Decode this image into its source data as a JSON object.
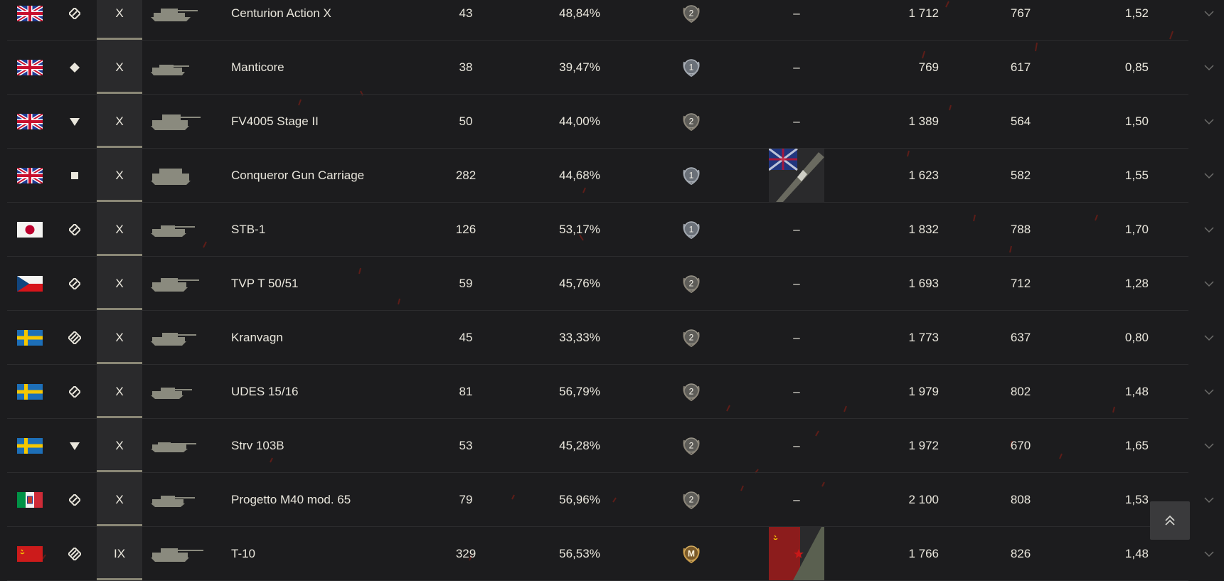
{
  "colors": {
    "background": "#1c1c1e",
    "row_border": "#2c2c2e",
    "text": "#e9e6dc",
    "tank_silhouette": "#8a8a7e",
    "tier_cell": "#2a2a2c",
    "tier_bar": "#8a8776"
  },
  "scroll_top_icon": "double-chevron-up-icon",
  "expand_icon": "chevron-down-icon",
  "rows": [
    {
      "nation": "uk",
      "class": "medium",
      "tier": "X",
      "name": "Centurion Action X",
      "battles": "43",
      "winrate": "48,84%",
      "mastery": "2",
      "mark": "–",
      "damage": "1 712",
      "xp": "767",
      "kd": "1,52"
    },
    {
      "nation": "uk",
      "class": "light",
      "tier": "X",
      "name": "Manticore",
      "battles": "38",
      "winrate": "39,47%",
      "mastery": "1",
      "mark": "–",
      "damage": "769",
      "xp": "617",
      "kd": "0,85"
    },
    {
      "nation": "uk",
      "class": "td",
      "tier": "X",
      "name": "FV4005 Stage II",
      "battles": "50",
      "winrate": "44,00%",
      "mastery": "2",
      "mark": "–",
      "damage": "1 389",
      "xp": "564",
      "kd": "1,50"
    },
    {
      "nation": "uk",
      "class": "spg",
      "tier": "X",
      "name": "Conqueror Gun Carriage",
      "battles": "282",
      "winrate": "44,68%",
      "mastery": "1",
      "mark": "gun-mark-uk",
      "damage": "1 623",
      "xp": "582",
      "kd": "1,55"
    },
    {
      "nation": "japan",
      "class": "medium",
      "tier": "X",
      "name": "STB-1",
      "battles": "126",
      "winrate": "53,17%",
      "mastery": "1",
      "mark": "–",
      "damage": "1 832",
      "xp": "788",
      "kd": "1,70"
    },
    {
      "nation": "czech",
      "class": "medium",
      "tier": "X",
      "name": "TVP T 50/51",
      "battles": "59",
      "winrate": "45,76%",
      "mastery": "2",
      "mark": "–",
      "damage": "1 693",
      "xp": "712",
      "kd": "1,28"
    },
    {
      "nation": "sweden",
      "class": "heavy",
      "tier": "X",
      "name": "Kranvagn",
      "battles": "45",
      "winrate": "33,33%",
      "mastery": "2",
      "mark": "–",
      "damage": "1 773",
      "xp": "637",
      "kd": "0,80"
    },
    {
      "nation": "sweden",
      "class": "medium",
      "tier": "X",
      "name": "UDES 15/16",
      "battles": "81",
      "winrate": "56,79%",
      "mastery": "2",
      "mark": "–",
      "damage": "1 979",
      "xp": "802",
      "kd": "1,48"
    },
    {
      "nation": "sweden",
      "class": "td",
      "tier": "X",
      "name": "Strv 103B",
      "battles": "53",
      "winrate": "45,28%",
      "mastery": "2",
      "mark": "–",
      "damage": "1 972",
      "xp": "670",
      "kd": "1,65"
    },
    {
      "nation": "italy",
      "class": "medium",
      "tier": "X",
      "name": "Progetto M40 mod. 65",
      "battles": "79",
      "winrate": "56,96%",
      "mastery": "2",
      "mark": "–",
      "damage": "2 100",
      "xp": "808",
      "kd": "1,53"
    },
    {
      "nation": "ussr",
      "class": "heavy",
      "tier": "IX",
      "name": "T-10",
      "battles": "329",
      "winrate": "56,53%",
      "mastery": "M",
      "mark": "gun-mark-ussr",
      "damage": "1 766",
      "xp": "826",
      "kd": "1,48"
    }
  ]
}
